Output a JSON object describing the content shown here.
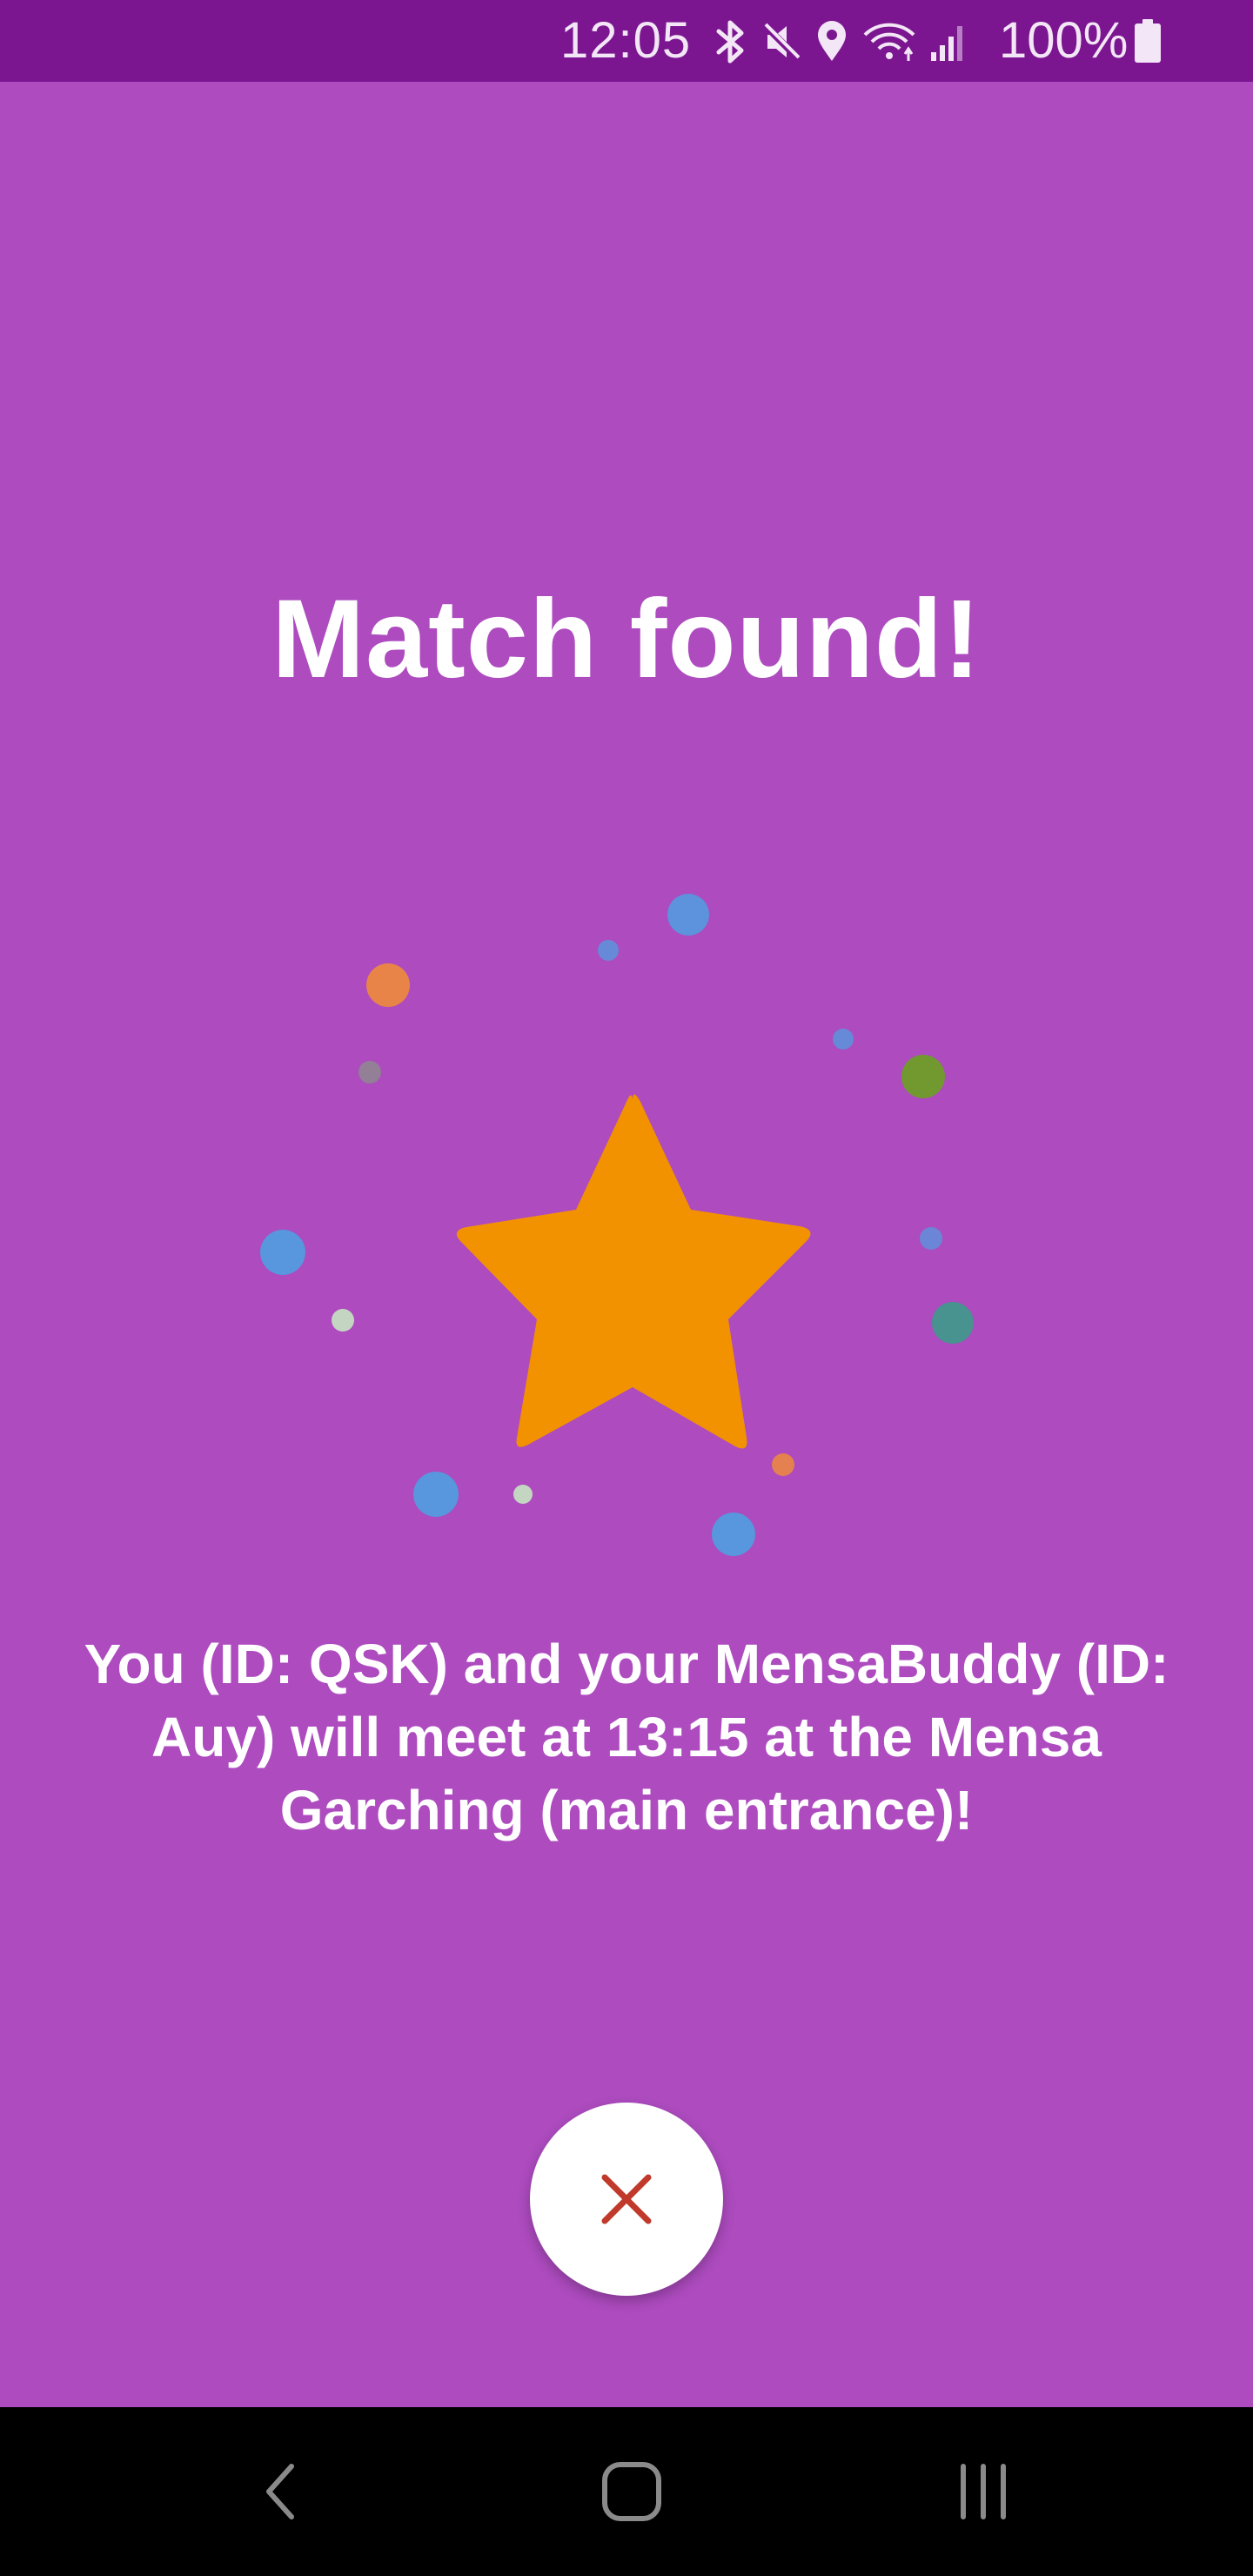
{
  "status_bar": {
    "time": "12:05",
    "battery": "100%",
    "icons": [
      "bluetooth-icon",
      "mute-icon",
      "location-icon",
      "wifi-icon",
      "signal-icon",
      "battery-icon"
    ],
    "background_color": "#7b1690"
  },
  "main": {
    "background_color": "#ad4bbf",
    "title": "Match found!",
    "illustration": {
      "icon": "star-icon",
      "star_color": "#f39200",
      "dot_colors": [
        "#4f9fe0",
        "#ef8b3c",
        "#6aa21f",
        "#3d9a8a",
        "#c7e6c2",
        "#8c8c8c"
      ]
    },
    "message": "You (ID: QSK) and your MensaBuddy (ID: Auy) will meet at 13:15 at the Mensa Garching (main entrance)!",
    "close_button": {
      "icon": "close-icon",
      "icon_color": "#c0392b"
    }
  },
  "nav_bar": {
    "buttons": [
      "back-icon",
      "home-icon",
      "recents-icon"
    ],
    "background_color": "#000000"
  }
}
